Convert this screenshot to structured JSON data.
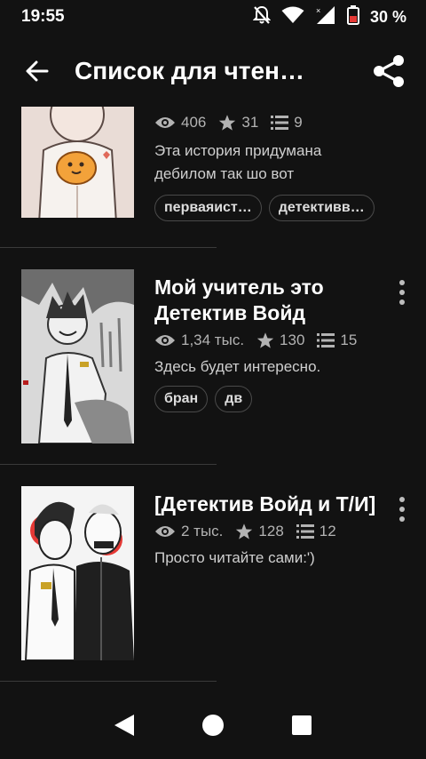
{
  "status_bar": {
    "time": "19:55",
    "battery": "30 %"
  },
  "app_bar": {
    "title": "Список для чтени…"
  },
  "stories": [
    {
      "title": "",
      "views": "406",
      "votes": "31",
      "parts": "9",
      "description": "Эта история придумана дебилом так шо вот",
      "tags": [
        "перваяист…",
        "детективв…"
      ]
    },
    {
      "title": "Мой учитель это Детектив Войд",
      "views": "1,34 тыс.",
      "votes": "130",
      "parts": "15",
      "description": "Здесь будет интересно.",
      "tags": [
        "бран",
        "дв"
      ]
    },
    {
      "title": "[Детектив Войд и Т/И]",
      "views": "2 тыс.",
      "votes": "128",
      "parts": "12",
      "description": "Просто читайте сами:')",
      "tags": []
    }
  ],
  "icons": {
    "back": "arrow-back-icon",
    "share": "share-icon",
    "views": "eye-icon",
    "votes": "star-icon",
    "parts": "list-icon",
    "more": "more-vert-icon"
  },
  "colors": {
    "background": "#121212",
    "divider": "#3a3a3a",
    "secondary_text": "#b3b3b3"
  }
}
